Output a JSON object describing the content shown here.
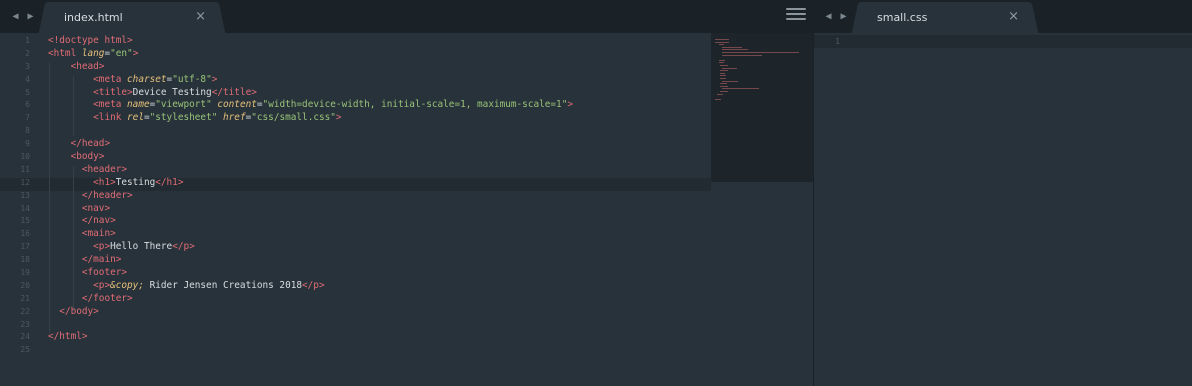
{
  "tabs": {
    "left": {
      "label": "index.html",
      "close": "×"
    },
    "right": {
      "label": "small.css",
      "close": "×"
    }
  },
  "nav": {
    "back": "◀",
    "forward": "▶"
  },
  "left_pane": {
    "line_numbers": [
      "1",
      "2",
      "3",
      "4",
      "5",
      "6",
      "7",
      "8",
      "9",
      "10",
      "11",
      "12",
      "13",
      "14",
      "15",
      "16",
      "17",
      "18",
      "19",
      "20",
      "21",
      "22",
      "23",
      "24",
      "25"
    ],
    "current_line": 12
  },
  "right_pane": {
    "line_numbers": [
      "1"
    ],
    "current_line": 1
  },
  "code_lines": [
    [
      {
        "c": "t",
        "x": "<!doctype html>"
      }
    ],
    [
      {
        "c": "t",
        "x": "<html "
      },
      {
        "c": "a",
        "x": "lang"
      },
      {
        "c": "p",
        "x": "="
      },
      {
        "c": "s",
        "x": "\"en\""
      },
      {
        "c": "t",
        "x": ">"
      }
    ],
    [
      {
        "c": "p",
        "x": "    "
      },
      {
        "c": "t",
        "x": "<head>"
      }
    ],
    [
      {
        "c": "p",
        "x": "        "
      },
      {
        "c": "t",
        "x": "<meta "
      },
      {
        "c": "a",
        "x": "charset"
      },
      {
        "c": "p",
        "x": "="
      },
      {
        "c": "s",
        "x": "\"utf-8\""
      },
      {
        "c": "t",
        "x": ">"
      }
    ],
    [
      {
        "c": "p",
        "x": "        "
      },
      {
        "c": "t",
        "x": "<title>"
      },
      {
        "c": "d",
        "x": "Device Testing"
      },
      {
        "c": "t",
        "x": "</title>"
      }
    ],
    [
      {
        "c": "p",
        "x": "        "
      },
      {
        "c": "t",
        "x": "<meta "
      },
      {
        "c": "a",
        "x": "name"
      },
      {
        "c": "p",
        "x": "="
      },
      {
        "c": "s",
        "x": "\"viewport\""
      },
      {
        "c": "p",
        "x": " "
      },
      {
        "c": "a",
        "x": "content"
      },
      {
        "c": "p",
        "x": "="
      },
      {
        "c": "s",
        "x": "\"width=device-width, initial-scale=1, maximum-scale=1\""
      },
      {
        "c": "t",
        "x": ">"
      }
    ],
    [
      {
        "c": "p",
        "x": "        "
      },
      {
        "c": "t",
        "x": "<link "
      },
      {
        "c": "a",
        "x": "rel"
      },
      {
        "c": "p",
        "x": "="
      },
      {
        "c": "s",
        "x": "\"stylesheet\""
      },
      {
        "c": "p",
        "x": " "
      },
      {
        "c": "a",
        "x": "href"
      },
      {
        "c": "p",
        "x": "="
      },
      {
        "c": "s",
        "x": "\"css/small.css\""
      },
      {
        "c": "t",
        "x": ">"
      }
    ],
    [],
    [
      {
        "c": "p",
        "x": "    "
      },
      {
        "c": "t",
        "x": "</head>"
      }
    ],
    [
      {
        "c": "p",
        "x": "    "
      },
      {
        "c": "t",
        "x": "<body>"
      }
    ],
    [
      {
        "c": "p",
        "x": "      "
      },
      {
        "c": "t",
        "x": "<header>"
      }
    ],
    [
      {
        "c": "p",
        "x": "        "
      },
      {
        "c": "t",
        "x": "<h1>"
      },
      {
        "c": "d",
        "x": "Testing"
      },
      {
        "c": "t",
        "x": "</h1>"
      }
    ],
    [
      {
        "c": "p",
        "x": "      "
      },
      {
        "c": "t",
        "x": "</header>"
      }
    ],
    [
      {
        "c": "p",
        "x": "      "
      },
      {
        "c": "t",
        "x": "<nav>"
      }
    ],
    [
      {
        "c": "p",
        "x": "      "
      },
      {
        "c": "t",
        "x": "</nav>"
      }
    ],
    [
      {
        "c": "p",
        "x": "      "
      },
      {
        "c": "t",
        "x": "<main>"
      }
    ],
    [
      {
        "c": "p",
        "x": "        "
      },
      {
        "c": "t",
        "x": "<p>"
      },
      {
        "c": "d",
        "x": "Hello There"
      },
      {
        "c": "t",
        "x": "</p>"
      }
    ],
    [
      {
        "c": "p",
        "x": "      "
      },
      {
        "c": "t",
        "x": "</main>"
      }
    ],
    [
      {
        "c": "p",
        "x": "      "
      },
      {
        "c": "t",
        "x": "<footer>"
      }
    ],
    [
      {
        "c": "p",
        "x": "        "
      },
      {
        "c": "t",
        "x": "<p>"
      },
      {
        "c": "a",
        "x": "&copy;"
      },
      {
        "c": "d",
        "x": " Rider Jensen Creations 2018"
      },
      {
        "c": "t",
        "x": "</p>"
      }
    ],
    [
      {
        "c": "p",
        "x": "      "
      },
      {
        "c": "t",
        "x": "</footer>"
      }
    ],
    [
      {
        "c": "p",
        "x": "  "
      },
      {
        "c": "t",
        "x": "</body>"
      }
    ],
    [],
    [
      {
        "c": "t",
        "x": "</html>"
      }
    ],
    []
  ]
}
